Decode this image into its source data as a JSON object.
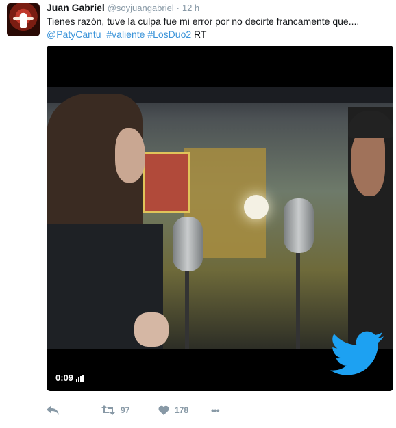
{
  "tweet": {
    "name": "Juan Gabriel",
    "handle": "@soyjuangabriel",
    "separator": "·",
    "time": "12 h",
    "text_line1": "Tienes razón, tuve la culpa fue mi error por no decirte francamente que....",
    "mention": "@PatyCantu",
    "hashtag1": "#valiente",
    "hashtag2": "#LosDuo2",
    "rt_text": "RT"
  },
  "video": {
    "duration": "0:09"
  },
  "actions": {
    "retweets": "97",
    "likes": "178",
    "more": "•••"
  },
  "colors": {
    "link": "#3b94d9",
    "muted": "#8899a6",
    "twitter_blue": "#1da1f2"
  }
}
